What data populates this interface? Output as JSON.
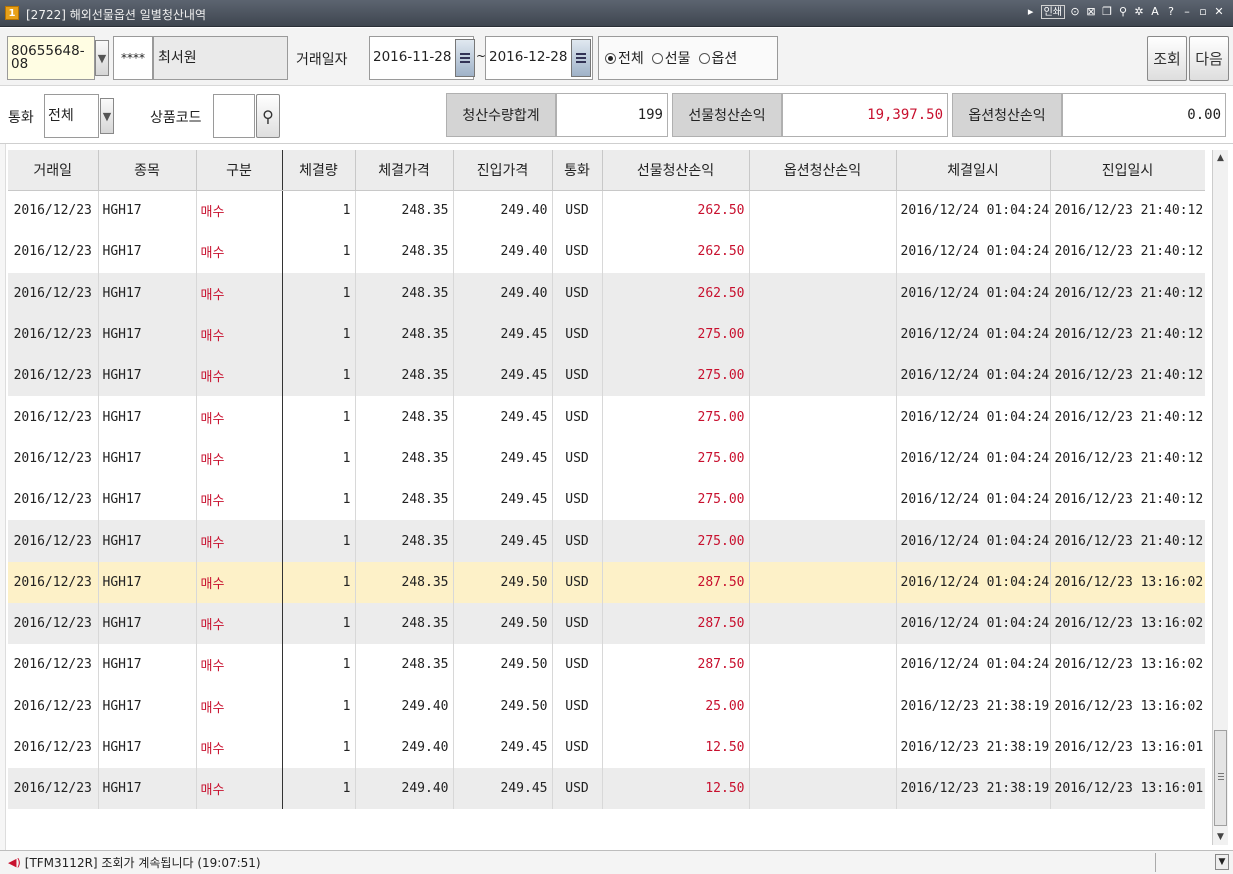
{
  "window": {
    "icon": "1",
    "title": "[2722] 해외선물옵션 일별청산내역",
    "tool_icons": [
      "link-icon",
      "print-icon",
      "mouse-icon",
      "close-small-icon",
      "copy-icon",
      "pin-icon",
      "settings-icon",
      "font-icon",
      "help-icon",
      "minimize-icon",
      "maximize-icon",
      "close-icon"
    ],
    "tool_print_label": "인쇄",
    "tool_font_label": "A",
    "tool_help_label": "?"
  },
  "filters": {
    "account_number": "80655648-08",
    "account_password": "****",
    "account_name": "최서원",
    "trade_date_label": "거래일자",
    "date_from": "2016-11-28",
    "date_separator": "~",
    "date_to": "2016-12-28",
    "type_options": [
      {
        "label": "전체",
        "selected": true
      },
      {
        "label": "선물",
        "selected": false
      },
      {
        "label": "옵션",
        "selected": false
      }
    ],
    "query_button": "조회",
    "next_button": "다음",
    "currency_label": "통화",
    "currency_value": "전체",
    "product_code_label": "상품코드",
    "product_code_value": ""
  },
  "summary": {
    "qty_total_label": "청산수량합계",
    "qty_total_value": "199",
    "futures_pl_label": "선물청산손익",
    "futures_pl_value": "19,397.50",
    "options_pl_label": "옵션청산손익",
    "options_pl_value": "0.00"
  },
  "table": {
    "columns": [
      "거래일",
      "종목",
      "구분",
      "체결량",
      "체결가격",
      "진입가격",
      "통화",
      "선물청산손익",
      "옵션청산손익",
      "체결일시",
      "진입일시"
    ],
    "rows": [
      {
        "date": "2016/12/23",
        "symbol": "HGH17",
        "side": "매수",
        "qty": "1",
        "exec_price": "248.35",
        "entry_price": "249.40",
        "currency": "USD",
        "fut_pl": "262.50",
        "opt_pl": "",
        "exec_time": "2016/12/24 01:04:24",
        "entry_time": "2016/12/23 21:40:12",
        "shade": false
      },
      {
        "date": "2016/12/23",
        "symbol": "HGH17",
        "side": "매수",
        "qty": "1",
        "exec_price": "248.35",
        "entry_price": "249.40",
        "currency": "USD",
        "fut_pl": "262.50",
        "opt_pl": "",
        "exec_time": "2016/12/24 01:04:24",
        "entry_time": "2016/12/23 21:40:12",
        "shade": false
      },
      {
        "date": "2016/12/23",
        "symbol": "HGH17",
        "side": "매수",
        "qty": "1",
        "exec_price": "248.35",
        "entry_price": "249.40",
        "currency": "USD",
        "fut_pl": "262.50",
        "opt_pl": "",
        "exec_time": "2016/12/24 01:04:24",
        "entry_time": "2016/12/23 21:40:12",
        "shade": true
      },
      {
        "date": "2016/12/23",
        "symbol": "HGH17",
        "side": "매수",
        "qty": "1",
        "exec_price": "248.35",
        "entry_price": "249.45",
        "currency": "USD",
        "fut_pl": "275.00",
        "opt_pl": "",
        "exec_time": "2016/12/24 01:04:24",
        "entry_time": "2016/12/23 21:40:12",
        "shade": true
      },
      {
        "date": "2016/12/23",
        "symbol": "HGH17",
        "side": "매수",
        "qty": "1",
        "exec_price": "248.35",
        "entry_price": "249.45",
        "currency": "USD",
        "fut_pl": "275.00",
        "opt_pl": "",
        "exec_time": "2016/12/24 01:04:24",
        "entry_time": "2016/12/23 21:40:12",
        "shade": true
      },
      {
        "date": "2016/12/23",
        "symbol": "HGH17",
        "side": "매수",
        "qty": "1",
        "exec_price": "248.35",
        "entry_price": "249.45",
        "currency": "USD",
        "fut_pl": "275.00",
        "opt_pl": "",
        "exec_time": "2016/12/24 01:04:24",
        "entry_time": "2016/12/23 21:40:12",
        "shade": false
      },
      {
        "date": "2016/12/23",
        "symbol": "HGH17",
        "side": "매수",
        "qty": "1",
        "exec_price": "248.35",
        "entry_price": "249.45",
        "currency": "USD",
        "fut_pl": "275.00",
        "opt_pl": "",
        "exec_time": "2016/12/24 01:04:24",
        "entry_time": "2016/12/23 21:40:12",
        "shade": false
      },
      {
        "date": "2016/12/23",
        "symbol": "HGH17",
        "side": "매수",
        "qty": "1",
        "exec_price": "248.35",
        "entry_price": "249.45",
        "currency": "USD",
        "fut_pl": "275.00",
        "opt_pl": "",
        "exec_time": "2016/12/24 01:04:24",
        "entry_time": "2016/12/23 21:40:12",
        "shade": false
      },
      {
        "date": "2016/12/23",
        "symbol": "HGH17",
        "side": "매수",
        "qty": "1",
        "exec_price": "248.35",
        "entry_price": "249.45",
        "currency": "USD",
        "fut_pl": "275.00",
        "opt_pl": "",
        "exec_time": "2016/12/24 01:04:24",
        "entry_time": "2016/12/23 21:40:12",
        "shade": true
      },
      {
        "date": "2016/12/23",
        "symbol": "HGH17",
        "side": "매수",
        "qty": "1",
        "exec_price": "248.35",
        "entry_price": "249.50",
        "currency": "USD",
        "fut_pl": "287.50",
        "opt_pl": "",
        "exec_time": "2016/12/24 01:04:24",
        "entry_time": "2016/12/23 13:16:02",
        "shade": false,
        "selected": true
      },
      {
        "date": "2016/12/23",
        "symbol": "HGH17",
        "side": "매수",
        "qty": "1",
        "exec_price": "248.35",
        "entry_price": "249.50",
        "currency": "USD",
        "fut_pl": "287.50",
        "opt_pl": "",
        "exec_time": "2016/12/24 01:04:24",
        "entry_time": "2016/12/23 13:16:02",
        "shade": true
      },
      {
        "date": "2016/12/23",
        "symbol": "HGH17",
        "side": "매수",
        "qty": "1",
        "exec_price": "248.35",
        "entry_price": "249.50",
        "currency": "USD",
        "fut_pl": "287.50",
        "opt_pl": "",
        "exec_time": "2016/12/24 01:04:24",
        "entry_time": "2016/12/23 13:16:02",
        "shade": false
      },
      {
        "date": "2016/12/23",
        "symbol": "HGH17",
        "side": "매수",
        "qty": "1",
        "exec_price": "249.40",
        "entry_price": "249.50",
        "currency": "USD",
        "fut_pl": "25.00",
        "opt_pl": "",
        "exec_time": "2016/12/23 21:38:19",
        "entry_time": "2016/12/23 13:16:02",
        "shade": false
      },
      {
        "date": "2016/12/23",
        "symbol": "HGH17",
        "side": "매수",
        "qty": "1",
        "exec_price": "249.40",
        "entry_price": "249.45",
        "currency": "USD",
        "fut_pl": "12.50",
        "opt_pl": "",
        "exec_time": "2016/12/23 21:38:19",
        "entry_time": "2016/12/23 13:16:01",
        "shade": false
      },
      {
        "date": "2016/12/23",
        "symbol": "HGH17",
        "side": "매수",
        "qty": "1",
        "exec_price": "249.40",
        "entry_price": "249.45",
        "currency": "USD",
        "fut_pl": "12.50",
        "opt_pl": "",
        "exec_time": "2016/12/23 21:38:19",
        "entry_time": "2016/12/23 13:16:01",
        "shade": true
      }
    ]
  },
  "status": {
    "message": "[TFM3112R] 조회가 계속됩니다 (19:07:51)"
  },
  "colors": {
    "profit": "#c8102e",
    "selected_row": "#fdf1c8",
    "title_bar": "#4a5260"
  }
}
